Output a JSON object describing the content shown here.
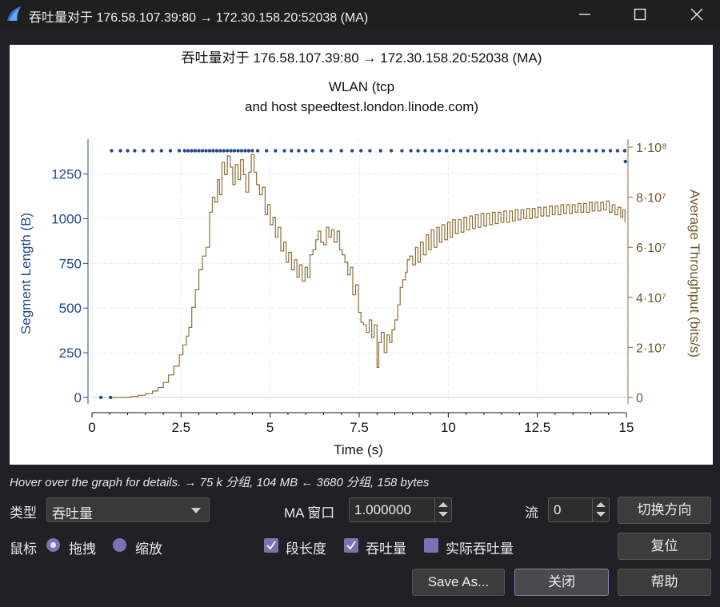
{
  "window": {
    "title": "吞吐量对于 176.58.107.39:80 → 172.30.158.20:52038 (MA)"
  },
  "chart_header": {
    "title": "吞吐量对于 176.58.107.39:80 → 172.30.158.20:52038 (MA)",
    "subtitle_line1": "WLAN (tcp",
    "subtitle_line2": "and host speedtest.london.linode.com)"
  },
  "chart_data": {
    "type": "scatter",
    "title": "吞吐量对于 176.58.107.39:80 → 172.30.158.20:52038 (MA)",
    "subtitle": "WLAN (tcp and host speedtest.london.linode.com)",
    "xlabel": "Time (s)",
    "ylabel_left": "Segment Length (B)",
    "ylabel_right": "Average Throughput (bits/s)",
    "xlim": [
      0,
      15
    ],
    "ylim_left": [
      0,
      1400
    ],
    "ylim_right": [
      0,
      100000000
    ],
    "x_ticks": [
      "0",
      "2.5",
      "5",
      "7.5",
      "10",
      "12.5",
      "15"
    ],
    "y_left_ticks": [
      "0",
      "250",
      "500",
      "750",
      "1000",
      "1250"
    ],
    "y_right_ticks": [
      "0",
      "2·10⁷",
      "4·10⁷",
      "6·10⁷",
      "8·10⁷",
      "1·10⁸"
    ],
    "grid": true,
    "colors": {
      "segment": "#23498a",
      "throughput": "#8b7138"
    },
    "series": [
      {
        "name": "段长度",
        "axis": "left",
        "style": "dots",
        "points": [
          [
            0.25,
            0
          ],
          [
            0.52,
            0
          ],
          [
            0.55,
            1380
          ],
          [
            0.8,
            1380
          ],
          [
            1.0,
            1380
          ],
          [
            1.2,
            1380
          ],
          [
            1.45,
            1380
          ],
          [
            1.7,
            1380
          ],
          [
            1.95,
            1380
          ],
          [
            2.2,
            1380
          ],
          [
            2.45,
            1380
          ],
          [
            2.6,
            1380
          ],
          [
            2.7,
            1380
          ],
          [
            2.8,
            1380
          ],
          [
            2.9,
            1380
          ],
          [
            3.0,
            1380
          ],
          [
            3.1,
            1380
          ],
          [
            3.2,
            1380
          ],
          [
            3.3,
            1380
          ],
          [
            3.4,
            1380
          ],
          [
            3.5,
            1380
          ],
          [
            3.6,
            1380
          ],
          [
            3.7,
            1380
          ],
          [
            3.8,
            1380
          ],
          [
            3.9,
            1380
          ],
          [
            4.0,
            1380
          ],
          [
            4.1,
            1380
          ],
          [
            4.2,
            1380
          ],
          [
            4.3,
            1380
          ],
          [
            4.4,
            1380
          ],
          [
            4.5,
            1380
          ],
          [
            4.65,
            1380
          ],
          [
            4.9,
            1380
          ],
          [
            5.15,
            1380
          ],
          [
            5.4,
            1380
          ],
          [
            5.6,
            1380
          ],
          [
            5.8,
            1380
          ],
          [
            6.0,
            1380
          ],
          [
            6.2,
            1380
          ],
          [
            6.45,
            1380
          ],
          [
            6.7,
            1380
          ],
          [
            7.0,
            1380
          ],
          [
            7.3,
            1380
          ],
          [
            7.55,
            1380
          ],
          [
            7.8,
            1380
          ],
          [
            8.1,
            1380
          ],
          [
            8.4,
            1380
          ],
          [
            8.7,
            1380
          ],
          [
            8.95,
            1380
          ],
          [
            9.15,
            1380
          ],
          [
            9.35,
            1380
          ],
          [
            9.55,
            1380
          ],
          [
            9.75,
            1380
          ],
          [
            9.95,
            1380
          ],
          [
            10.15,
            1380
          ],
          [
            10.35,
            1380
          ],
          [
            10.55,
            1380
          ],
          [
            10.75,
            1380
          ],
          [
            10.95,
            1380
          ],
          [
            11.15,
            1380
          ],
          [
            11.35,
            1380
          ],
          [
            11.55,
            1380
          ],
          [
            11.75,
            1380
          ],
          [
            11.95,
            1380
          ],
          [
            12.15,
            1380
          ],
          [
            12.35,
            1380
          ],
          [
            12.55,
            1380
          ],
          [
            12.75,
            1380
          ],
          [
            12.95,
            1380
          ],
          [
            13.15,
            1380
          ],
          [
            13.35,
            1380
          ],
          [
            13.55,
            1380
          ],
          [
            13.75,
            1380
          ],
          [
            13.95,
            1380
          ],
          [
            14.15,
            1380
          ],
          [
            14.35,
            1380
          ],
          [
            14.55,
            1380
          ],
          [
            14.75,
            1380
          ],
          [
            14.95,
            1380
          ],
          [
            14.97,
            1320
          ]
        ]
      },
      {
        "name": "吞吐量",
        "axis": "right",
        "style": "step-line",
        "points": [
          [
            0.5,
            0
          ],
          [
            0.95,
            100000
          ],
          [
            1.1,
            400000
          ],
          [
            1.3,
            900000
          ],
          [
            1.5,
            1500000
          ],
          [
            1.7,
            2600000
          ],
          [
            1.85,
            4000000
          ],
          [
            2.0,
            6000000
          ],
          [
            2.15,
            9000000
          ],
          [
            2.3,
            12500000
          ],
          [
            2.45,
            17000000
          ],
          [
            2.55,
            21000000
          ],
          [
            2.65,
            24500000
          ],
          [
            2.72,
            28000000
          ],
          [
            2.8,
            36000000
          ],
          [
            2.9,
            43000000
          ],
          [
            3.0,
            51000000
          ],
          [
            3.1,
            56500000
          ],
          [
            3.2,
            60000000
          ],
          [
            3.3,
            74000000
          ],
          [
            3.38,
            80000000
          ],
          [
            3.45,
            78000000
          ],
          [
            3.52,
            87000000
          ],
          [
            3.58,
            81000000
          ],
          [
            3.65,
            94000000
          ],
          [
            3.72,
            89000000
          ],
          [
            3.8,
            96500000
          ],
          [
            3.88,
            92000000
          ],
          [
            3.95,
            85000000
          ],
          [
            4.02,
            93000000
          ],
          [
            4.1,
            87000000
          ],
          [
            4.17,
            95000000
          ],
          [
            4.25,
            89000000
          ],
          [
            4.32,
            82000000
          ],
          [
            4.4,
            90000000
          ],
          [
            4.47,
            97000000
          ],
          [
            4.55,
            90000000
          ],
          [
            4.62,
            85000000
          ],
          [
            4.7,
            81000000
          ],
          [
            4.78,
            84000000
          ],
          [
            4.86,
            73000000
          ],
          [
            4.93,
            77000000
          ],
          [
            5.0,
            69000000
          ],
          [
            5.08,
            72000000
          ],
          [
            5.15,
            64000000
          ],
          [
            5.22,
            68000000
          ],
          [
            5.3,
            58500000
          ],
          [
            5.38,
            62000000
          ],
          [
            5.45,
            54000000
          ],
          [
            5.52,
            58000000
          ],
          [
            5.6,
            51000000
          ],
          [
            5.68,
            55000000
          ],
          [
            5.75,
            48000000
          ],
          [
            5.82,
            53000000
          ],
          [
            5.9,
            46500000
          ],
          [
            5.98,
            52000000
          ],
          [
            6.05,
            48000000
          ],
          [
            6.12,
            57000000
          ],
          [
            6.2,
            59000000
          ],
          [
            6.28,
            63000000
          ],
          [
            6.35,
            66500000
          ],
          [
            6.42,
            62000000
          ],
          [
            6.5,
            61000000
          ],
          [
            6.58,
            68000000
          ],
          [
            6.65,
            64000000
          ],
          [
            6.72,
            67000000
          ],
          [
            6.8,
            62000000
          ],
          [
            6.88,
            66500000
          ],
          [
            6.95,
            59000000
          ],
          [
            7.02,
            57000000
          ],
          [
            7.1,
            54000000
          ],
          [
            7.18,
            49000000
          ],
          [
            7.25,
            52000000
          ],
          [
            7.32,
            41000000
          ],
          [
            7.4,
            45000000
          ],
          [
            7.48,
            34000000
          ],
          [
            7.55,
            30000000
          ],
          [
            7.62,
            29000000
          ],
          [
            7.7,
            26000000
          ],
          [
            7.78,
            31000000
          ],
          [
            7.85,
            24000000
          ],
          [
            7.92,
            29000000
          ],
          [
            8.0,
            12000000
          ],
          [
            8.05,
            22000000
          ],
          [
            8.12,
            26000000
          ],
          [
            8.2,
            18000000
          ],
          [
            8.28,
            25000000
          ],
          [
            8.35,
            22000000
          ],
          [
            8.42,
            27000000
          ],
          [
            8.5,
            31000000
          ],
          [
            8.58,
            37000000
          ],
          [
            8.65,
            44000000
          ],
          [
            8.72,
            47000000
          ],
          [
            8.8,
            50000000
          ],
          [
            8.85,
            55000000
          ],
          [
            8.92,
            56500000
          ],
          [
            9.0,
            53000000
          ],
          [
            9.08,
            60000000
          ],
          [
            9.15,
            54000000
          ],
          [
            9.22,
            62000000
          ],
          [
            9.3,
            57000000
          ],
          [
            9.38,
            65000000
          ],
          [
            9.45,
            59000000
          ],
          [
            9.52,
            67000000
          ],
          [
            9.6,
            60000000
          ],
          [
            9.68,
            68000000
          ],
          [
            9.75,
            62000000
          ],
          [
            9.82,
            69000000
          ],
          [
            9.9,
            63000000
          ],
          [
            9.98,
            70000000
          ],
          [
            10.05,
            64000000
          ],
          [
            10.12,
            71000000
          ],
          [
            10.2,
            65500000
          ],
          [
            10.28,
            71000000
          ],
          [
            10.36,
            66000000
          ],
          [
            10.44,
            72000000
          ],
          [
            10.52,
            67000000
          ],
          [
            10.6,
            72500000
          ],
          [
            10.68,
            67500000
          ],
          [
            10.76,
            73000000
          ],
          [
            10.84,
            68000000
          ],
          [
            10.92,
            73500000
          ],
          [
            11.0,
            68500000
          ],
          [
            11.08,
            73500000
          ],
          [
            11.16,
            69000000
          ],
          [
            11.24,
            74000000
          ],
          [
            11.32,
            69500000
          ],
          [
            11.4,
            74000000
          ],
          [
            11.48,
            70000000
          ],
          [
            11.56,
            74500000
          ],
          [
            11.64,
            70000000
          ],
          [
            11.72,
            74500000
          ],
          [
            11.8,
            70500000
          ],
          [
            11.88,
            75000000
          ],
          [
            11.96,
            71000000
          ],
          [
            12.04,
            75000000
          ],
          [
            12.12,
            71500000
          ],
          [
            12.2,
            75500000
          ],
          [
            12.28,
            71500000
          ],
          [
            12.36,
            75500000
          ],
          [
            12.44,
            72000000
          ],
          [
            12.52,
            76000000
          ],
          [
            12.6,
            72500000
          ],
          [
            12.68,
            76000000
          ],
          [
            12.76,
            72500000
          ],
          [
            12.84,
            76500000
          ],
          [
            12.92,
            73000000
          ],
          [
            13.0,
            76500000
          ],
          [
            13.08,
            73000000
          ],
          [
            13.16,
            77000000
          ],
          [
            13.24,
            73500000
          ],
          [
            13.32,
            77000000
          ],
          [
            13.4,
            73500000
          ],
          [
            13.48,
            77000000
          ],
          [
            13.56,
            74000000
          ],
          [
            13.64,
            77500000
          ],
          [
            13.72,
            74000000
          ],
          [
            13.8,
            77500000
          ],
          [
            13.88,
            74000000
          ],
          [
            13.96,
            78000000
          ],
          [
            14.04,
            74500000
          ],
          [
            14.12,
            78000000
          ],
          [
            14.2,
            74500000
          ],
          [
            14.28,
            78000000
          ],
          [
            14.36,
            75000000
          ],
          [
            14.44,
            78500000
          ],
          [
            14.52,
            74000000
          ],
          [
            14.6,
            77000000
          ],
          [
            14.68,
            73000000
          ],
          [
            14.76,
            76000000
          ],
          [
            14.84,
            72000000
          ],
          [
            14.9,
            75000000
          ],
          [
            14.96,
            70000000
          ]
        ]
      }
    ]
  },
  "hint": {
    "text": "Hover over the graph for details. → 75 k 分组, 104 MB ← 3680 分组, 158 bytes"
  },
  "controls": {
    "type_label": "类型",
    "type_value": "吞吐量",
    "ma_label": "MA 窗口",
    "ma_value": "1.000000",
    "stream_label": "流",
    "stream_value": "0",
    "switch_direction": "切换方向",
    "mouse_label": "鼠标",
    "drag_label": "拖拽",
    "zoom_label": "缩放",
    "seg_length_label": "段长度",
    "throughput_label": "吞吐量",
    "goodput_label": "实际吞吐量",
    "reset": "复位",
    "save_as": "Save As...",
    "close": "关闭",
    "help": "帮助"
  }
}
